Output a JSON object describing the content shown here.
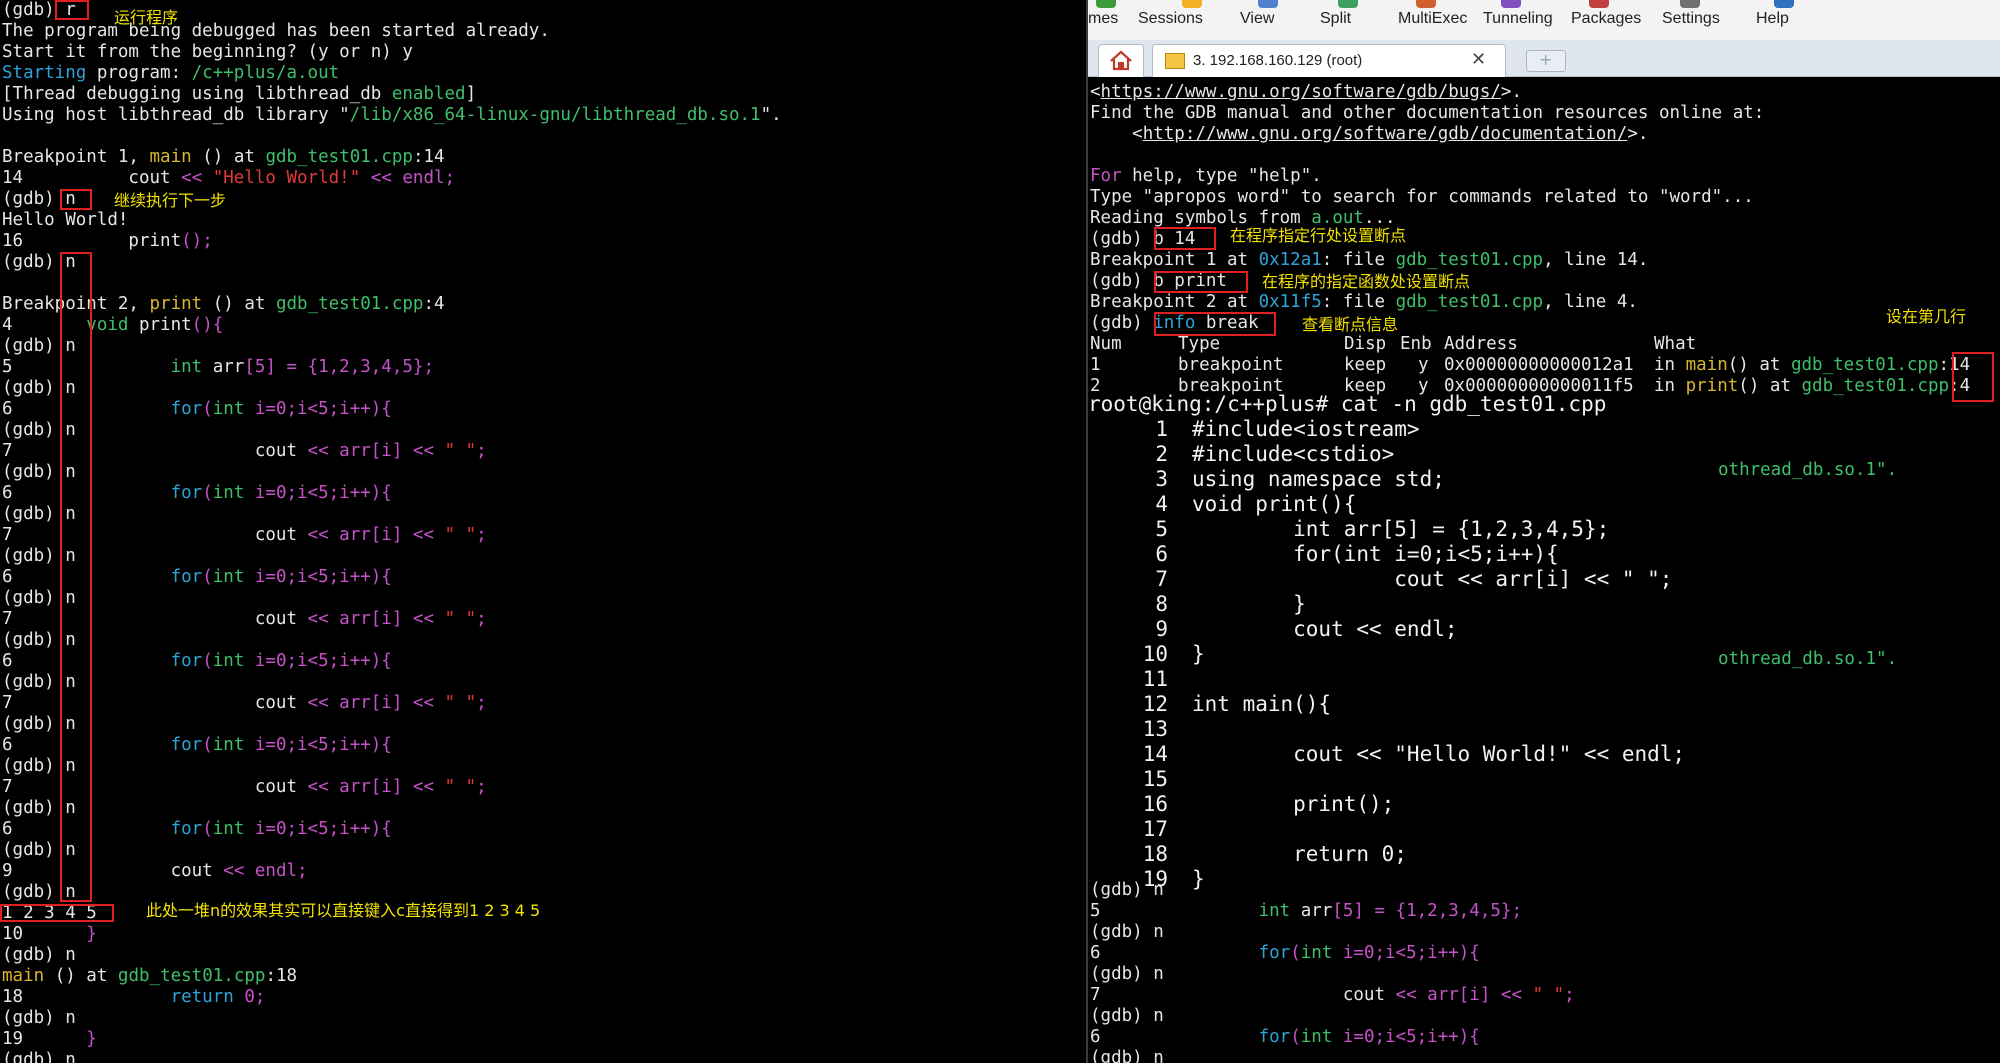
{
  "left_terminal": {
    "lines": [
      [
        {
          "t": "(gdb) ",
          "c": "white"
        },
        {
          "t": "r",
          "c": "white"
        }
      ],
      [
        {
          "t": "The program being debugged has been started already.",
          "c": "white"
        }
      ],
      [
        {
          "t": "Start it from the beginning? (y or n) y",
          "c": "white"
        }
      ],
      [
        {
          "t": "Starting",
          "c": "cyan"
        },
        {
          "t": " program: ",
          "c": "white"
        },
        {
          "t": "/c++plus/a.out",
          "c": "green"
        }
      ],
      [
        {
          "t": "[Thread debugging using libthread_db ",
          "c": "white"
        },
        {
          "t": "enabled",
          "c": "green"
        },
        {
          "t": "]",
          "c": "white"
        }
      ],
      [
        {
          "t": "Using host libthread_db library \"",
          "c": "white"
        },
        {
          "t": "/lib/x86_64-linux-gnu/libthread_db.so.1",
          "c": "green"
        },
        {
          "t": "\".",
          "c": "white"
        }
      ],
      [
        {
          "t": "",
          "c": "white"
        }
      ],
      [
        {
          "t": "Breakpoint 1, ",
          "c": "white"
        },
        {
          "t": "main",
          "c": "yellow"
        },
        {
          "t": " () at ",
          "c": "white"
        },
        {
          "t": "gdb_test01.cpp",
          "c": "green"
        },
        {
          "t": ":14",
          "c": "white"
        }
      ],
      [
        {
          "t": "14          cout ",
          "c": "white"
        },
        {
          "t": "<< ",
          "c": "mag"
        },
        {
          "t": "\"Hello World!\"",
          "c": "red"
        },
        {
          "t": " << endl;",
          "c": "mag"
        }
      ],
      [
        {
          "t": "(gdb) n",
          "c": "white"
        }
      ],
      [
        {
          "t": "Hello World!",
          "c": "white"
        }
      ],
      [
        {
          "t": "16          print",
          "c": "white"
        },
        {
          "t": "();",
          "c": "mag"
        }
      ],
      [
        {
          "t": "(gdb) n",
          "c": "white"
        }
      ],
      [
        {
          "t": "",
          "c": "white"
        }
      ],
      [
        {
          "t": "Breakpoint 2, ",
          "c": "white"
        },
        {
          "t": "print",
          "c": "yellow"
        },
        {
          "t": " () at ",
          "c": "white"
        },
        {
          "t": "gdb_test01.cpp",
          "c": "green"
        },
        {
          "t": ":4",
          "c": "white"
        }
      ],
      [
        {
          "t": "4       ",
          "c": "white"
        },
        {
          "t": "void",
          "c": "green"
        },
        {
          "t": " print",
          "c": "white"
        },
        {
          "t": "(){",
          "c": "mag"
        }
      ],
      [
        {
          "t": "(gdb) n",
          "c": "white"
        }
      ],
      [
        {
          "t": "5               ",
          "c": "white"
        },
        {
          "t": "int",
          "c": "green"
        },
        {
          "t": " arr",
          "c": "white"
        },
        {
          "t": "[5]",
          "c": "mag"
        },
        {
          "t": " = {1,2,3,4,5};",
          "c": "mag"
        }
      ],
      [
        {
          "t": "(gdb) n",
          "c": "white"
        }
      ],
      [
        {
          "t": "6               ",
          "c": "white"
        },
        {
          "t": "for",
          "c": "cyan"
        },
        {
          "t": "(",
          "c": "mag"
        },
        {
          "t": "int",
          "c": "green"
        },
        {
          "t": " i=0;i<5;i++){",
          "c": "mag"
        }
      ],
      [
        {
          "t": "(gdb) n",
          "c": "white"
        }
      ],
      [
        {
          "t": "7                       cout ",
          "c": "white"
        },
        {
          "t": "<< arr[i] << ",
          "c": "mag"
        },
        {
          "t": "\" \"",
          "c": "red"
        },
        {
          "t": ";",
          "c": "mag"
        }
      ],
      [
        {
          "t": "(gdb) n",
          "c": "white"
        }
      ],
      [
        {
          "t": "6               ",
          "c": "white"
        },
        {
          "t": "for",
          "c": "cyan"
        },
        {
          "t": "(",
          "c": "mag"
        },
        {
          "t": "int",
          "c": "green"
        },
        {
          "t": " i=0;i<5;i++){",
          "c": "mag"
        }
      ],
      [
        {
          "t": "(gdb) n",
          "c": "white"
        }
      ],
      [
        {
          "t": "7                       cout ",
          "c": "white"
        },
        {
          "t": "<< arr[i] << ",
          "c": "mag"
        },
        {
          "t": "\" \"",
          "c": "red"
        },
        {
          "t": ";",
          "c": "mag"
        }
      ],
      [
        {
          "t": "(gdb) n",
          "c": "white"
        }
      ],
      [
        {
          "t": "6               ",
          "c": "white"
        },
        {
          "t": "for",
          "c": "cyan"
        },
        {
          "t": "(",
          "c": "mag"
        },
        {
          "t": "int",
          "c": "green"
        },
        {
          "t": " i=0;i<5;i++){",
          "c": "mag"
        }
      ],
      [
        {
          "t": "(gdb) n",
          "c": "white"
        }
      ],
      [
        {
          "t": "7                       cout ",
          "c": "white"
        },
        {
          "t": "<< arr[i] << ",
          "c": "mag"
        },
        {
          "t": "\" \"",
          "c": "red"
        },
        {
          "t": ";",
          "c": "mag"
        }
      ],
      [
        {
          "t": "(gdb) n",
          "c": "white"
        }
      ],
      [
        {
          "t": "6               ",
          "c": "white"
        },
        {
          "t": "for",
          "c": "cyan"
        },
        {
          "t": "(",
          "c": "mag"
        },
        {
          "t": "int",
          "c": "green"
        },
        {
          "t": " i=0;i<5;i++){",
          "c": "mag"
        }
      ],
      [
        {
          "t": "(gdb) n",
          "c": "white"
        }
      ],
      [
        {
          "t": "7                       cout ",
          "c": "white"
        },
        {
          "t": "<< arr[i] << ",
          "c": "mag"
        },
        {
          "t": "\" \"",
          "c": "red"
        },
        {
          "t": ";",
          "c": "mag"
        }
      ],
      [
        {
          "t": "(gdb) n",
          "c": "white"
        }
      ],
      [
        {
          "t": "6               ",
          "c": "white"
        },
        {
          "t": "for",
          "c": "cyan"
        },
        {
          "t": "(",
          "c": "mag"
        },
        {
          "t": "int",
          "c": "green"
        },
        {
          "t": " i=0;i<5;i++){",
          "c": "mag"
        }
      ],
      [
        {
          "t": "(gdb) n",
          "c": "white"
        }
      ],
      [
        {
          "t": "7                       cout ",
          "c": "white"
        },
        {
          "t": "<< arr[i] << ",
          "c": "mag"
        },
        {
          "t": "\" \"",
          "c": "red"
        },
        {
          "t": ";",
          "c": "mag"
        }
      ],
      [
        {
          "t": "(gdb) n",
          "c": "white"
        }
      ],
      [
        {
          "t": "6               ",
          "c": "white"
        },
        {
          "t": "for",
          "c": "cyan"
        },
        {
          "t": "(",
          "c": "mag"
        },
        {
          "t": "int",
          "c": "green"
        },
        {
          "t": " i=0;i<5;i++){",
          "c": "mag"
        }
      ],
      [
        {
          "t": "(gdb) n",
          "c": "white"
        }
      ],
      [
        {
          "t": "9               cout ",
          "c": "white"
        },
        {
          "t": "<< endl;",
          "c": "mag"
        }
      ],
      [
        {
          "t": "(gdb) n",
          "c": "white"
        }
      ],
      [
        {
          "t": "1 2 3 4 5",
          "c": "white"
        }
      ],
      [
        {
          "t": "10      ",
          "c": "white"
        },
        {
          "t": "}",
          "c": "mag"
        }
      ],
      [
        {
          "t": "(gdb) n",
          "c": "white"
        }
      ],
      [
        {
          "t": "main",
          "c": "yellow"
        },
        {
          "t": " () at ",
          "c": "white"
        },
        {
          "t": "gdb_test01.cpp",
          "c": "green"
        },
        {
          "t": ":18",
          "c": "white"
        }
      ],
      [
        {
          "t": "18              ",
          "c": "white"
        },
        {
          "t": "return",
          "c": "cyan"
        },
        {
          "t": " 0;",
          "c": "mag"
        }
      ],
      [
        {
          "t": "(gdb) n",
          "c": "white"
        }
      ],
      [
        {
          "t": "19      ",
          "c": "white"
        },
        {
          "t": "}",
          "c": "mag"
        }
      ],
      [
        {
          "t": "(gdb) n",
          "c": "white"
        }
      ]
    ],
    "annotations": {
      "run": "运行程序",
      "next": "继续执行下一步",
      "continue_tip": "此处一堆n的效果其实可以直接键入c直接得到1 2 3 4 5"
    }
  },
  "toolbar": {
    "items": [
      {
        "label": "mes",
        "icon_color": "#3a9c3a"
      },
      {
        "label": "Sessions",
        "icon_color": "#f0b020"
      },
      {
        "label": "View",
        "icon_color": "#5080d0"
      },
      {
        "label": "Split",
        "icon_color": "#40a060"
      },
      {
        "label": "MultiExec",
        "icon_color": "#d06030"
      },
      {
        "label": "Tunneling",
        "icon_color": "#8050c0"
      },
      {
        "label": "Packages",
        "icon_color": "#c04040"
      },
      {
        "label": "Settings",
        "icon_color": "#707070"
      },
      {
        "label": "Help",
        "icon_color": "#3070c0"
      }
    ]
  },
  "tabs": {
    "home_icon": "home-icon",
    "active_tab_label": "3. 192.168.160.129 (root)",
    "close_glyph": "✕",
    "new_tab_glyph": "+"
  },
  "right_terminal": {
    "lines": [
      [
        {
          "t": "<",
          "c": "white"
        },
        {
          "t": "https://www.gnu.org/software/gdb/bugs/",
          "c": "white",
          "u": true
        },
        {
          "t": ">.",
          "c": "white"
        }
      ],
      [
        {
          "t": "Find the GDB manual and other documentation resources online at:",
          "c": "white"
        }
      ],
      [
        {
          "t": "    <",
          "c": "white"
        },
        {
          "t": "http://www.gnu.org/software/gdb/documentation/",
          "c": "white",
          "u": true
        },
        {
          "t": ">.",
          "c": "white"
        }
      ],
      [
        {
          "t": "",
          "c": "white"
        }
      ],
      [
        {
          "t": "For",
          "c": "mag"
        },
        {
          "t": " help, type \"help\".",
          "c": "white"
        }
      ],
      [
        {
          "t": "Type \"apropos word\" to search for commands related to \"word\"...",
          "c": "white"
        }
      ],
      [
        {
          "t": "Reading symbols from ",
          "c": "white"
        },
        {
          "t": "a.out",
          "c": "green"
        },
        {
          "t": "...",
          "c": "white"
        }
      ],
      [
        {
          "t": "(gdb) b 14",
          "c": "white"
        }
      ],
      [
        {
          "t": "Breakpoint 1 at ",
          "c": "white"
        },
        {
          "t": "0x12a1",
          "c": "cyan"
        },
        {
          "t": ": file ",
          "c": "white"
        },
        {
          "t": "gdb_test01.cpp",
          "c": "green"
        },
        {
          "t": ", line 14.",
          "c": "white"
        }
      ],
      [
        {
          "t": "(gdb) b print",
          "c": "white"
        }
      ],
      [
        {
          "t": "Breakpoint 2 at ",
          "c": "white"
        },
        {
          "t": "0x11f5",
          "c": "cyan"
        },
        {
          "t": ": file ",
          "c": "white"
        },
        {
          "t": "gdb_test01.cpp",
          "c": "green"
        },
        {
          "t": ", line 4.",
          "c": "white"
        }
      ],
      [
        {
          "t": "(gdb) ",
          "c": "white"
        },
        {
          "t": "info",
          "c": "cyan"
        },
        {
          "t": " break",
          "c": "white"
        }
      ]
    ],
    "table_header": {
      "num": "Num",
      "type": "Type",
      "disp": "Disp",
      "enb": "Enb",
      "address": "Address",
      "what": "What"
    },
    "table_rows": [
      {
        "num": "1",
        "type": "breakpoint",
        "disp": "keep",
        "enb": "y",
        "address": "0x00000000000012a1",
        "in": "in ",
        "func": "main",
        "at": "() at ",
        "file": "gdb_test01.cpp",
        "line": ":14"
      },
      {
        "num": "2",
        "type": "breakpoint",
        "disp": "keep",
        "enb": "y",
        "address": "0x00000000000011f5",
        "in": "in ",
        "func": "print",
        "at": "() at ",
        "file": "gdb_test01.cpp",
        "line": ":4"
      }
    ],
    "bottom_lines": [
      [
        {
          "t": "(gdb) n",
          "c": "white"
        }
      ],
      [
        {
          "t": "5               ",
          "c": "white"
        },
        {
          "t": "int",
          "c": "green"
        },
        {
          "t": " arr",
          "c": "white"
        },
        {
          "t": "[5]",
          "c": "mag"
        },
        {
          "t": " = {1,2,3,4,5};",
          "c": "mag"
        }
      ],
      [
        {
          "t": "(gdb) n",
          "c": "white"
        }
      ],
      [
        {
          "t": "6               ",
          "c": "white"
        },
        {
          "t": "for",
          "c": "cyan"
        },
        {
          "t": "(",
          "c": "mag"
        },
        {
          "t": "int",
          "c": "green"
        },
        {
          "t": " i=0;i<5;i++){",
          "c": "mag"
        }
      ],
      [
        {
          "t": "(gdb) n",
          "c": "white"
        }
      ],
      [
        {
          "t": "7                       cout ",
          "c": "white"
        },
        {
          "t": "<< arr[i] << ",
          "c": "mag"
        },
        {
          "t": "\" \"",
          "c": "red"
        },
        {
          "t": ";",
          "c": "mag"
        }
      ],
      [
        {
          "t": "(gdb) n",
          "c": "white"
        }
      ],
      [
        {
          "t": "6               ",
          "c": "white"
        },
        {
          "t": "for",
          "c": "cyan"
        },
        {
          "t": "(",
          "c": "mag"
        },
        {
          "t": "int",
          "c": "green"
        },
        {
          "t": " i=0;i<5;i++){",
          "c": "mag"
        }
      ],
      [
        {
          "t": "(gdb) n",
          "c": "white"
        }
      ]
    ],
    "hidden_fragments": [
      "othread_db.so.1\".",
      "othread_db.so.1\"."
    ],
    "annotations": {
      "b14": "在程序指定行处设置断点",
      "bprint": "在程序的指定函数处设置断点",
      "info": "查看断点信息",
      "line_no": "设在第几行"
    }
  },
  "cat_output": {
    "command": "root@king:/c++plus# cat -n gdb_test01.cpp",
    "lines": [
      {
        "n": "1",
        "code": "#include<iostream>"
      },
      {
        "n": "2",
        "code": "#include<cstdio>"
      },
      {
        "n": "3",
        "code": "using namespace std;"
      },
      {
        "n": "4",
        "code": "void print(){"
      },
      {
        "n": "5",
        "code": "        int arr[5] = {1,2,3,4,5};"
      },
      {
        "n": "6",
        "code": "        for(int i=0;i<5;i++){"
      },
      {
        "n": "7",
        "code": "                cout << arr[i] << \" \";"
      },
      {
        "n": "8",
        "code": "        }"
      },
      {
        "n": "9",
        "code": "        cout << endl;"
      },
      {
        "n": "10",
        "code": "}"
      },
      {
        "n": "11",
        "code": ""
      },
      {
        "n": "12",
        "code": "int main(){"
      },
      {
        "n": "13",
        "code": ""
      },
      {
        "n": "14",
        "code": "        cout << \"Hello World!\" << endl;"
      },
      {
        "n": "15",
        "code": ""
      },
      {
        "n": "16",
        "code": "        print();"
      },
      {
        "n": "17",
        "code": ""
      },
      {
        "n": "18",
        "code": "        return 0;"
      },
      {
        "n": "19",
        "code": "}"
      }
    ]
  }
}
